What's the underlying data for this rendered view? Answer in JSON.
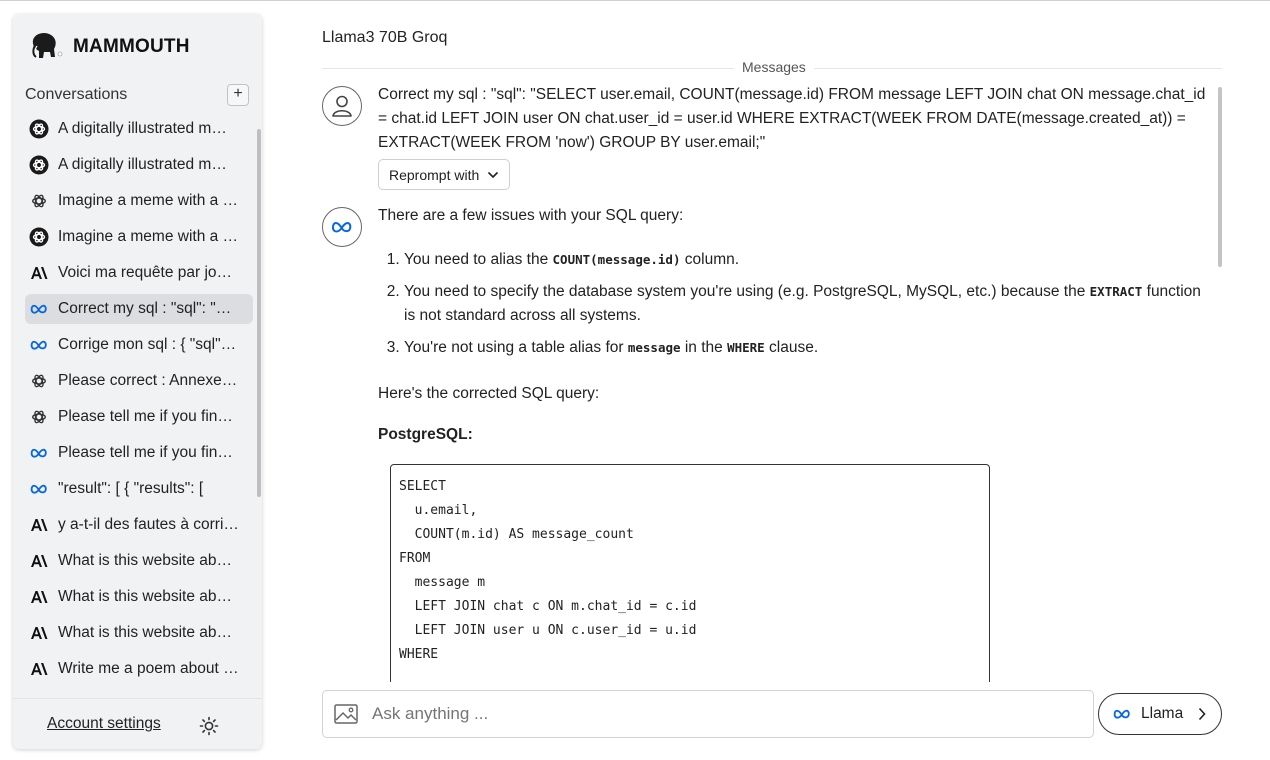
{
  "app": {
    "brand_name": "MAMMOUTH",
    "accent_color": "#0668E1"
  },
  "sidebar": {
    "conversations_title": "Conversations",
    "new_conversation_label": "+",
    "items": [
      {
        "icon": "openai-dark-icon",
        "label": "A digitally illustrated m…",
        "active": false
      },
      {
        "icon": "openai-dark-icon",
        "label": "A digitally illustrated m…",
        "active": false
      },
      {
        "icon": "openai-light-icon",
        "label": "Imagine a meme with a …",
        "active": false
      },
      {
        "icon": "openai-dark-icon",
        "label": "Imagine a meme with a …",
        "active": false
      },
      {
        "icon": "anthropic-icon",
        "label": "Voici ma requête par jo…",
        "active": false
      },
      {
        "icon": "meta-icon",
        "label": "Correct my sql : \"sql\": \"S…",
        "active": true
      },
      {
        "icon": "meta-icon",
        "label": "Corrige mon sql : { \"sql\":…",
        "active": false
      },
      {
        "icon": "openai-light-icon",
        "label": "Please correct : Annexe …",
        "active": false
      },
      {
        "icon": "openai-light-icon",
        "label": "Please tell me if you find…",
        "active": false
      },
      {
        "icon": "meta-icon",
        "label": "Please tell me if you find…",
        "active": false
      },
      {
        "icon": "meta-icon",
        "label": "\"result\": [ { \"results\": [",
        "active": false
      },
      {
        "icon": "anthropic-icon",
        "label": "y a-t-il des fautes à corri…",
        "active": false
      },
      {
        "icon": "anthropic-icon",
        "label": "What is this website ab…",
        "active": false
      },
      {
        "icon": "anthropic-icon",
        "label": "What is this website ab…",
        "active": false
      },
      {
        "icon": "anthropic-icon",
        "label": "What is this website ab…",
        "active": false
      },
      {
        "icon": "anthropic-icon",
        "label": "Write me a poem about …",
        "active": false
      }
    ],
    "account_settings": "Account settings",
    "theme_icon": "sun-icon"
  },
  "main": {
    "model_title": "Llama3 70B Groq",
    "messages_label": "Messages",
    "user_message": "Correct my sql : \"sql\": \"SELECT user.email, COUNT(message.id) FROM message LEFT JOIN chat ON message.chat_id = chat.id LEFT JOIN user ON chat.user_id = user.id WHERE EXTRACT(WEEK FROM DATE(message.created_at)) = EXTRACT(WEEK FROM 'now') GROUP BY user.email;\"",
    "reprompt_label": "Reprompt with",
    "bot": {
      "intro": "There are a few issues with your SQL query:",
      "issue1_pre": "You need to alias the ",
      "issue1_code": "COUNT(message.id)",
      "issue1_post": " column.",
      "issue2_pre": "You need to specify the database system you're using (e.g. PostgreSQL, MySQL, etc.) because the ",
      "issue2_code": "EXTRACT",
      "issue2_post": " function is not standard across all systems.",
      "issue3_pre": "You're not using a table alias for ",
      "issue3_code": "message",
      "issue3_mid": " in the ",
      "issue3_code2": "WHERE",
      "issue3_post": " clause.",
      "corrected_intro": "Here's the corrected SQL query:",
      "dialect_heading": "PostgreSQL:",
      "code": "SELECT\n  u.email,\n  COUNT(m.id) AS message_count\nFROM\n  message m\n  LEFT JOIN chat c ON m.chat_id = c.id\n  LEFT JOIN user u ON c.user_id = u.id\nWHERE"
    }
  },
  "composer": {
    "placeholder": "Ask anything ...",
    "model_button_label": "Llama"
  }
}
